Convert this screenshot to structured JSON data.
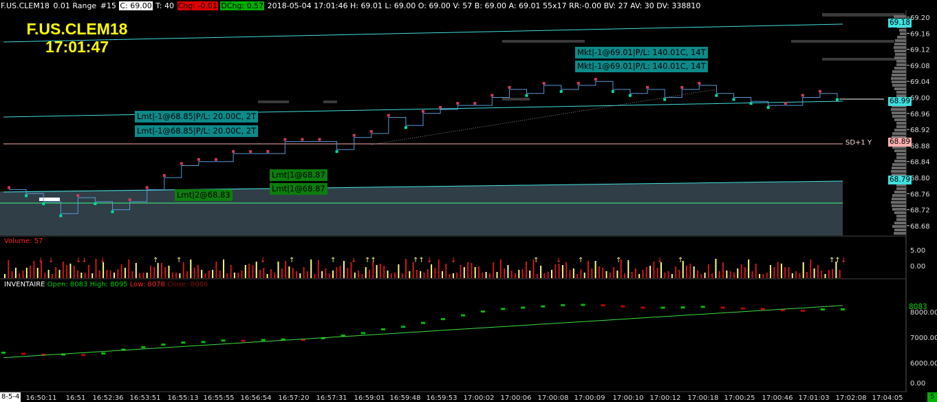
{
  "header": {
    "symbol": "F.US.CLEM18",
    "bar_type": "0.01 Range",
    "bar_num": "#15",
    "close_label": "C: 69.00",
    "ticks_label": "T: 40",
    "chg_label": "Chg: -0.01",
    "dchg_label": "DChg: 0.57",
    "info": "2018-05-04 17:01:46 H: 69.01 L: 69.00 O: 69.00 V: 57 B: 69.00 A: 69.01 55x17 RR:-0.00 BV: 27 AV: 30 DV: 338810"
  },
  "overlay": {
    "symbol": "F.US.CLEM18",
    "time": "17:01:47"
  },
  "orders": [
    "Mkt|-1@69.01|P/L: 140.01C, 14T",
    "Mkt|-1@69.01|P/L: 140.01C, 14T",
    "Lmt|-1@68.85|P/L: 20.00C, 2T",
    "Lmt|-1@68.85|P/L: 20.00C, 2T",
    "Lmt|1@68.87",
    "Lmt|1@68.87",
    "Lmt|2@68.83"
  ],
  "price_tags": {
    "upper": "69.18",
    "current": "68.99",
    "sd": "68.89",
    "lower": "68.79"
  },
  "sd_label": "SD+1 Y",
  "volume_label": "Volume: 57",
  "indicator": {
    "name": "INVENTAIRE",
    "open": "Open: 8083",
    "high": "High: 8095",
    "low": "Low: 8078",
    "close": "Close: 8086",
    "tag": "8083"
  },
  "footer": {
    "date": "8-5-4",
    "badge": "5"
  },
  "colors": {
    "up": "#d33a5a",
    "down": "#00e0a0",
    "band": "#2f3e47",
    "channel": "#40e0e0",
    "sd": "#ffb0b0",
    "vol_up": "#ffff80",
    "vol_down": "#d01818",
    "inv_up": "#00c000",
    "inv_down": "#c00000"
  },
  "chart_data": [
    {
      "type": "line",
      "title": "F.US.CLEM18 0.01 Range",
      "x": [
        "16:50:11",
        "16:51",
        "16:52:36",
        "16:53:51",
        "16:55:13",
        "16:55:55",
        "16:56:54",
        "16:57:20",
        "16:57:31",
        "16:59:01",
        "16:59:48",
        "16:59:53",
        "17:00:02",
        "17:00:06",
        "17:00:08",
        "17:00:09",
        "17:00:10",
        "17:00:12",
        "17:00:18",
        "17:00:25",
        "17:00:46",
        "17:01:03",
        "17:02:08",
        "17:04:05"
      ],
      "ylim": [
        68.66,
        69.22
      ],
      "y_ticks": [
        "69.20",
        "69.16",
        "69.12",
        "69.08",
        "69.04",
        "69.00",
        "68.96",
        "68.92",
        "68.88",
        "68.84",
        "68.80",
        "68.76",
        "68.72",
        "68.68"
      ],
      "series": [
        {
          "values": [
            68.77,
            68.76,
            68.74,
            68.71,
            68.75,
            68.74,
            68.72,
            68.74,
            68.77,
            68.8,
            68.83,
            68.84,
            68.84,
            68.86,
            68.86,
            68.86,
            68.89,
            68.89,
            68.89,
            68.87,
            68.9,
            68.91,
            68.95,
            68.93,
            68.96,
            68.97,
            68.98,
            68.98,
            69.0,
            69.02,
            69.01,
            69.03,
            69.02,
            69.03,
            69.04,
            69.02,
            69.01,
            69.02,
            69.0,
            69.02,
            69.03,
            69.01,
            69.0,
            68.99,
            68.98,
            68.98,
            69.0,
            69.01,
            69.0
          ]
        }
      ]
    },
    {
      "type": "bar",
      "title": "Volume: 57",
      "ylim": [
        0,
        5
      ],
      "y_ticks": [
        "5.00",
        "0.00"
      ]
    },
    {
      "type": "line",
      "title": "INVENTAIRE",
      "ylim": [
        5600,
        8900
      ],
      "y_ticks": [
        "8000.00",
        "7000.00",
        "6000.00",
        "0.00"
      ],
      "series": [
        {
          "name": "INVENTAIRE",
          "values": [
            6380,
            6340,
            6300,
            6310,
            6290,
            6350,
            6500,
            6600,
            6700,
            6780,
            6800,
            6860,
            6850,
            6880,
            6900,
            6880,
            6950,
            7050,
            7150,
            7300,
            7400,
            7550,
            7700,
            7850,
            8000,
            8100,
            8150,
            8200,
            8250,
            8260,
            8240,
            8200,
            8150,
            8150,
            8160,
            8180,
            8150,
            8120,
            8100,
            8050,
            8030,
            8080,
            8083
          ]
        }
      ]
    }
  ],
  "time_ticks": [
    "16:50:11",
    "16:51",
    "16:52:36",
    "16:53:51",
    "16:55:13",
    "16:55:55",
    "16:56:54",
    "16:57:20",
    "16:57:31",
    "16:59:01",
    "16:59:48",
    "16:59:53",
    "17:00:02",
    "17:00:06",
    "17:00:08",
    "17:00:09",
    "17:00:10",
    "17:00:12",
    "17:00:18",
    "17:00:25",
    "17:00:46",
    "17:01:03",
    "17:02:08",
    "17:04:05"
  ]
}
